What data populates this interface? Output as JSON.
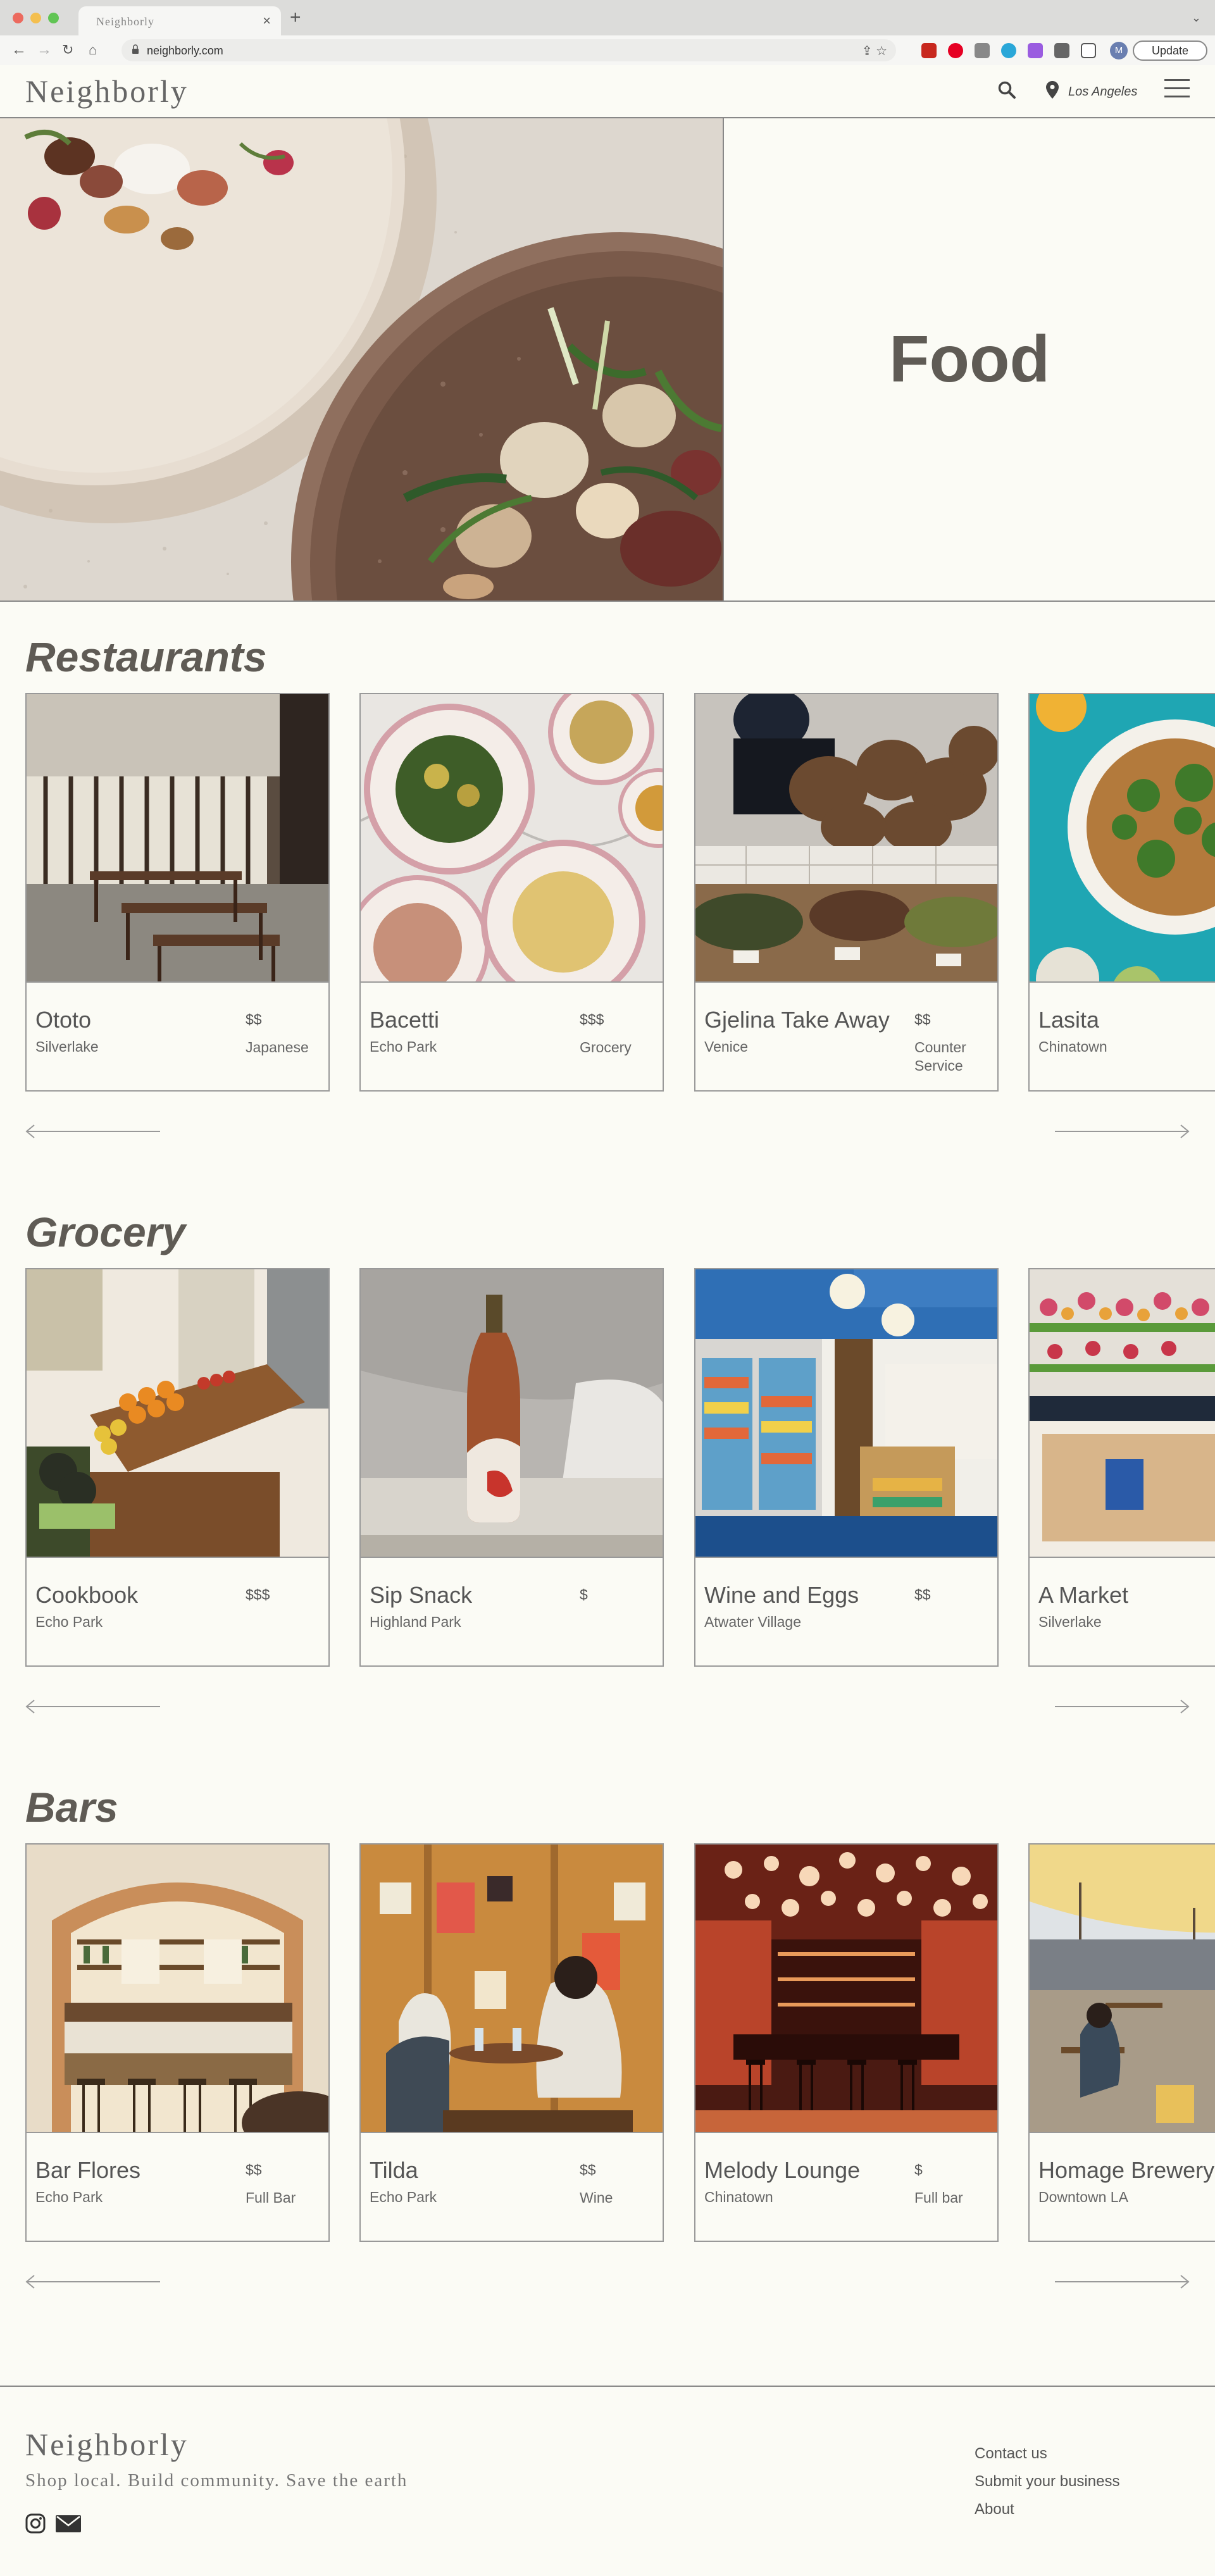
{
  "browser": {
    "tab_title": "Neighborly",
    "url": "neighborly.com",
    "update_label": "Update",
    "profile_initial": "M"
  },
  "site": {
    "logo": "Neighborly",
    "location": "Los Angeles"
  },
  "hero": {
    "title": "Food"
  },
  "sections": [
    {
      "title": "Restaurants",
      "cards": [
        {
          "name": "Ototo",
          "area": "Silverlake",
          "price": "$$",
          "type": "Japanese"
        },
        {
          "name": "Bacetti",
          "area": "Echo Park",
          "price": "$$$",
          "type": "Grocery"
        },
        {
          "name": "Gjelina Take Away",
          "area": "Venice",
          "price": "$$",
          "type": "Counter Service"
        },
        {
          "name": "Lasita",
          "area": "Chinatown",
          "price": "",
          "type": ""
        }
      ]
    },
    {
      "title": "Grocery",
      "cards": [
        {
          "name": "Cookbook",
          "area": "Echo Park",
          "price": "$$$",
          "type": ""
        },
        {
          "name": "Sip Snack",
          "area": "Highland Park",
          "price": "$",
          "type": ""
        },
        {
          "name": "Wine and Eggs",
          "area": "Atwater Village",
          "price": "$$",
          "type": ""
        },
        {
          "name": "A Market",
          "area": "Silverlake",
          "price": "",
          "type": ""
        }
      ]
    },
    {
      "title": "Bars",
      "cards": [
        {
          "name": "Bar Flores",
          "area": "Echo Park",
          "price": "$$",
          "type": "Full Bar"
        },
        {
          "name": "Tilda",
          "area": "Echo Park",
          "price": "$$",
          "type": "Wine"
        },
        {
          "name": "Melody Lounge",
          "area": "Chinatown",
          "price": "$",
          "type": "Full bar"
        },
        {
          "name": "Homage Brewery",
          "area": "Downtown LA",
          "price": "",
          "type": ""
        }
      ]
    }
  ],
  "footer": {
    "logo": "Neighborly",
    "tagline": "Shop local. Build community. Save the earth",
    "links": [
      "Contact us",
      "Submit your business",
      "About"
    ]
  },
  "icons": {
    "search": "search-icon",
    "location": "map-pin-icon",
    "menu": "hamburger-menu-icon",
    "instagram": "instagram-icon",
    "email": "mail-icon",
    "prev": "arrow-left-icon",
    "next": "arrow-right-icon"
  }
}
